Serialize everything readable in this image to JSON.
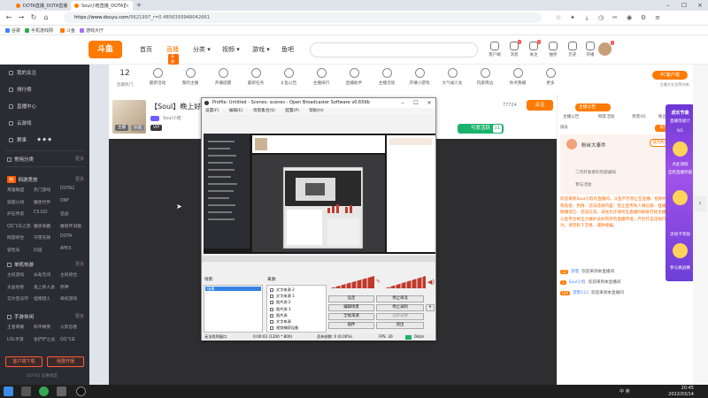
{
  "browser": {
    "tabs": [
      {
        "title": "DOTA直播_DOTA直播视频在线观看_斗鱼直播",
        "active": false
      },
      {
        "title": "Soul小晗直播_DOTA直播_斗鱼直播",
        "active": true
      }
    ],
    "new_tab": "+",
    "address": {
      "host": "https://www.douyu.com",
      "path": "/5621997_r=0.4856393948042661"
    },
    "bookmarks": [
      "谷歌",
      "手机游戏网",
      "斗鱼",
      "游戏大厅"
    ]
  },
  "header": {
    "logo": "斗鱼",
    "nav": [
      "首页",
      "直播",
      "分类",
      "视频",
      "游戏",
      "鱼吧"
    ],
    "nav_badge": "直播",
    "icons": [
      {
        "name": "客户端",
        "badge": ""
      },
      {
        "name": "消息",
        "badge": "4"
      },
      {
        "name": "关注",
        "badge": "5"
      },
      {
        "name": "抽奖",
        "badge": ""
      },
      {
        "name": "历史",
        "badge": ""
      },
      {
        "name": "开播",
        "badge": ""
      }
    ],
    "avatar_badge": "3"
  },
  "sidebar": {
    "items": [
      "我的关注",
      "排行榜",
      "直播中心",
      "云游戏",
      "赛事"
    ],
    "sections": [
      {
        "title": "常用分类",
        "more": "更多"
      },
      {
        "title": "网游竞技",
        "tag": "热",
        "more": "更多"
      },
      {
        "title": "单机热游",
        "more": "更多"
      },
      {
        "title": "手游休闲",
        "more": "更多"
      }
    ],
    "grid_netgame": [
      "英雄联盟",
      "热门游戏",
      "DOTA2",
      "穿越火线",
      "魔兽世界",
      "DNF",
      "炉石传说",
      "CS:GO",
      "逆战",
      "QQ飞车之旅",
      "魔兽争霸",
      "魔兽怀旧服",
      "网游综合",
      "守望先锋",
      "DOTA",
      "冒险岛",
      "问道",
      "APEX"
    ],
    "grid_single": [
      "主机游戏",
      "永劫无间",
      "主机综合",
      "太吾绘卷",
      "鬼上新人类",
      "原神",
      "艾尔登法环",
      "怪物猎人",
      "单机游戏"
    ],
    "grid_mobile": [
      "王者荣耀",
      "和平精英",
      "火影忍者",
      "LOL手游",
      "金铲铲之战",
      "QQ飞车"
    ],
    "buttons": [
      "客户端下载",
      "我要开播"
    ],
    "footer": "DOTA2 竞赛联盟"
  },
  "categories": {
    "count": "12",
    "count_label": "近期热门",
    "items": [
      "最新活动",
      "我的主播",
      "开播提醒",
      "最新任务",
      "斗鱼公告",
      "主播排行",
      "直播助手",
      "主播活动",
      "开播小游戏",
      "大气候少女",
      "玩家周边",
      "你点我播",
      "更多"
    ],
    "pc_button": "PC客户端",
    "pc_sub": "主播大礼包等你来"
  },
  "room": {
    "title": "【Soul】晚上好。",
    "host": "Soul小晗",
    "tags": [
      "主播",
      "认证",
      "VIP"
    ],
    "count": "77724",
    "follow": "关注",
    "like": "可爱活跃",
    "like_count": "11"
  },
  "obs": {
    "title": "Profile: Untitled - Scenes: scenes - Open Broadcaster Software v0.659b",
    "menu": [
      "设置(F)",
      "编辑(E)",
      "场景集合(S)",
      "配置(P)",
      "帮助(H)"
    ],
    "scenes_label": "场景:",
    "sources_label": "来源:",
    "scene_selected": "场景",
    "sources": [
      "文字来源 2",
      "文字来源 1",
      "图片源 2",
      "图片源 3",
      "图片源",
      "文字来源",
      "视频捕获设备"
    ],
    "buttons": [
      "设定",
      "停止串流",
      "编辑场景",
      "停止录制",
      "全视来源",
      "选择录像",
      "插件",
      "退出"
    ],
    "status": {
      "left": "无法找到窗口",
      "time": "0:00:02 (1200 * 800)",
      "fps": "FPS: 30",
      "dropped": "丢失帧数: 0 (0.00%)",
      "speed": "0kb/s"
    }
  },
  "chat": {
    "tabs": [
      "主播公告",
      "网友活动",
      "贵宾(0)",
      "粉丝团"
    ],
    "announcement_btn": "主播公告",
    "rank": "排队",
    "hot": "排行榜",
    "fans_title": "粉丝大事件",
    "fans_btn": "成为粉丝",
    "fans_lines": [
      "二月开发者的内部通知",
      "参与活动"
    ],
    "system_msg": "欢迎来到Soul小晗的直播间。斗鱼严厉禁止在直播、视频中出现低俗、色情、违法违规内容，禁止宣传私人微信群、直播勿散播谣言、违法信息。未经允许请勿在直播间刷屏打扰主播。斗鱼平台将全力维护良好有序的直播环境，严厉打击违规行为。请勿私下交易，谨防被骗。",
    "messages": [
      {
        "lv": "12",
        "name": "游客",
        "text": "欢迎来到本直播间"
      },
      {
        "lv": "3",
        "name": "Soul小晗",
        "text": "欢迎来到本直播间"
      },
      {
        "lv": "LV9",
        "name": "游客123",
        "text": "欢迎来到本直播间"
      }
    ]
  },
  "promo": {
    "title": "成长节奏",
    "subtitle": "直播等级计",
    "progress": "0/1",
    "line1": "点此领取",
    "line2": "全民直播奖励",
    "line3": "流动卡奖励",
    "line4": "参与挑战赛"
  },
  "taskbar": {
    "time": "20:45",
    "date": "2022/03/14",
    "tray": "中 英"
  }
}
